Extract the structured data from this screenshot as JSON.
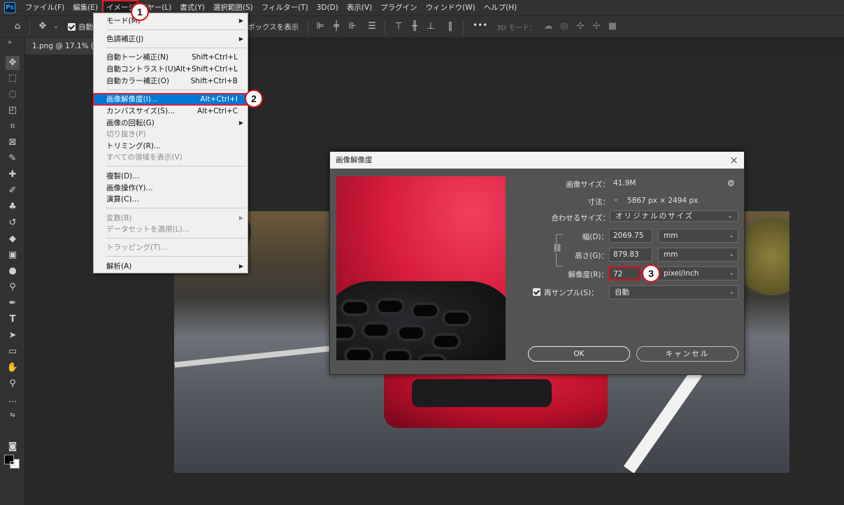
{
  "menubar": {
    "logo": "Ps",
    "items": [
      "ファイル(F)",
      "編集(E)",
      "イメージ(I)",
      "イヤー(L)",
      "書式(Y)",
      "選択範囲(S)",
      "フィルター(T)",
      "3D(D)",
      "表示(V)",
      "プラグイン",
      "ウィンドウ(W)",
      "ヘルプ(H)"
    ]
  },
  "optionsbar": {
    "auto_label": "自動",
    "bbox_label": "ボックスを表示",
    "more": "•••",
    "mode3d_label": "3D モード："
  },
  "document_tab": "1.png @ 17.1% (RG",
  "image_menu": {
    "items": [
      {
        "label": "モード(M)",
        "submenu": true
      },
      {
        "label": "色調補正(J)",
        "submenu": true
      },
      {
        "label": "自動トーン補正(N)",
        "shortcut": "Shift+Ctrl+L"
      },
      {
        "label": "自動コントラスト(U)",
        "shortcut": "Alt+Shift+Ctrl+L"
      },
      {
        "label": "自動カラー補正(O)",
        "shortcut": "Shift+Ctrl+B"
      },
      {
        "label": "画像解像度(I)...",
        "shortcut": "Alt+Ctrl+I"
      },
      {
        "label": "カンバスサイズ(S)...",
        "shortcut": "Alt+Ctrl+C"
      },
      {
        "label": "画像の回転(G)",
        "submenu": true
      },
      {
        "label": "切り抜き(P)"
      },
      {
        "label": "トリミング(R)..."
      },
      {
        "label": "すべての領域を表示(V)"
      },
      {
        "label": "複製(D)..."
      },
      {
        "label": "画像操作(Y)..."
      },
      {
        "label": "演算(C)..."
      },
      {
        "label": "変数(B)",
        "submenu": true
      },
      {
        "label": "データセットを適用(L)..."
      },
      {
        "label": "トラッピング(T)..."
      },
      {
        "label": "解析(A)",
        "submenu": true
      }
    ]
  },
  "callouts": [
    "1",
    "2",
    "3"
  ],
  "dialog": {
    "title": "画像解像度",
    "close": "×",
    "image_size_label": "画像サイズ：",
    "image_size_value": "41.9M",
    "dimensions_label": "寸法：",
    "dimensions_value": "5867 px × 2494 px",
    "fit_label": "合わせるサイズ：",
    "fit_value": "オリジナルのサイズ",
    "width_label": "幅(D)：",
    "width_value": "2069.75",
    "width_unit": "mm",
    "height_label": "高さ(G)：",
    "height_value": "879.83",
    "height_unit": "mm",
    "resolution_label": "解像度(R)：",
    "resolution_value": "72",
    "resolution_unit": "pixel/inch",
    "resample_label": "再サンプル(S)：",
    "resample_value": "自動",
    "ok_label": "OK",
    "cancel_label": "キャンセル"
  },
  "colors": {
    "highlight": "#0078d7",
    "callout_red": "#d8101f"
  }
}
